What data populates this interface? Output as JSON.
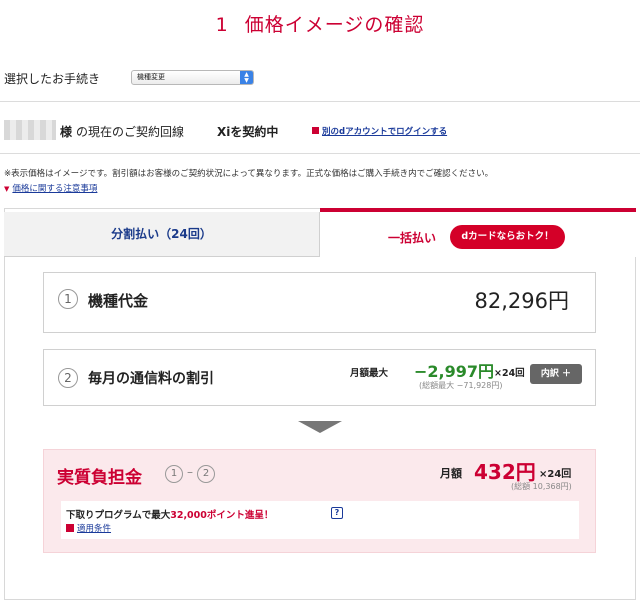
{
  "header": {
    "step_number": "1",
    "title": "価格イメージの確認"
  },
  "procedure": {
    "label": "選択したお手続き",
    "selected": "機種変更"
  },
  "contract": {
    "honorific": "様",
    "current_line_text": "の現在のご契約回線",
    "plan": "Xiを契約中",
    "login_link": "別のdアカウントでログインする"
  },
  "notes": {
    "disclaimer": "※表示価格はイメージです。割引額はお客様のご契約状況によって異なります。正式な価格はご購入手続き内でご確認ください。",
    "price_notice_link": "価格に関する注意事項"
  },
  "tabs": {
    "installment": "分割払い（24回）",
    "lump_sum": "一括払い",
    "dcard_badge": "dカードならおトク！"
  },
  "device_price": {
    "number": "1",
    "label": "機種代金",
    "price": "82,296円"
  },
  "monthly_discount": {
    "number": "2",
    "label": "毎月の通信料の割引",
    "prefix": "月額最大",
    "amount": "−2,997円",
    "times": "×24回",
    "total": "(総額最大 −71,928円)",
    "breakdown_button": "内訳 ＋"
  },
  "actual_cost": {
    "title": "実質負担金",
    "formula_num1": "1",
    "formula_dash": "–",
    "formula_num2": "2",
    "monthly_label": "月額",
    "monthly_amount": "432円",
    "times": "×24回",
    "total": "(総額 10,368円)",
    "promo_text_before": "下取りプログラムで最大",
    "promo_points": "32,000ポイント進呈！",
    "help_icon": "?",
    "conditions_link": "適用条件"
  },
  "colors": {
    "accent_red": "#cc0033",
    "link_blue": "#1a3a9a",
    "discount_green": "#2a8a2a"
  }
}
